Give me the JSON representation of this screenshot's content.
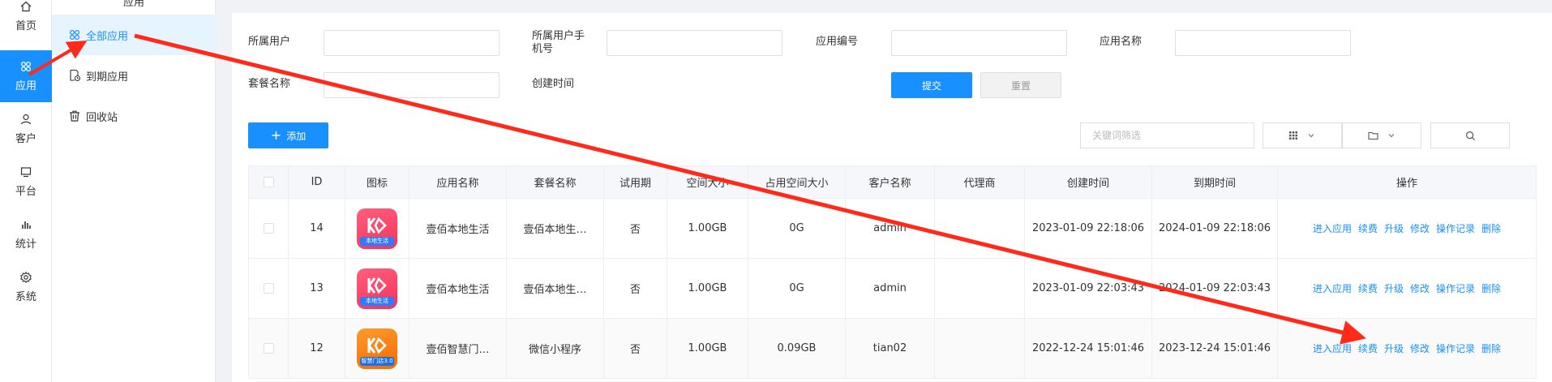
{
  "rail": {
    "items": [
      {
        "label": "首页",
        "icon": "home-icon"
      },
      {
        "label": "应用",
        "icon": "apps-icon"
      },
      {
        "label": "客户",
        "icon": "user-icon"
      },
      {
        "label": "平台",
        "icon": "monitor-icon"
      },
      {
        "label": "统计",
        "icon": "bar-chart-icon"
      },
      {
        "label": "系统",
        "icon": "gear-icon"
      }
    ],
    "active_color": "#1890ff"
  },
  "submenu": {
    "title": "应用",
    "items": [
      {
        "label": "全部应用",
        "icon": "apps-icon"
      },
      {
        "label": "到期应用",
        "icon": "expire-doc-icon"
      },
      {
        "label": "回收站",
        "icon": "trash-icon"
      }
    ]
  },
  "filters": {
    "owner_label": "所属用户",
    "phone_label_line1": "所属用户手",
    "phone_label_line2": "机号",
    "app_no_label": "应用编号",
    "app_name_label": "应用名称",
    "package_label": "套餐名称",
    "created_label": "创建时间",
    "submit": "提交",
    "reset": "重置"
  },
  "toolbar": {
    "add": "添加",
    "keyword_placeholder": "关键词筛选"
  },
  "table": {
    "headers": [
      "ID",
      "图标",
      "应用名称",
      "套餐名称",
      "试用期",
      "空间大小",
      "占用空间大小",
      "客户名称",
      "代理商",
      "创建时间",
      "到期时间",
      "操作"
    ],
    "rows": [
      {
        "id": "14",
        "icon_badge": "本地生活",
        "icon_style": "pink",
        "app_name": "壹佰本地生活",
        "package": "壹佰本地生…",
        "trial": "否",
        "space": "1.00GB",
        "used": "0G",
        "customer": "admin",
        "agent": "",
        "created": "2023-01-09 22:18:06",
        "expires": "2024-01-09 22:18:06"
      },
      {
        "id": "13",
        "icon_badge": "本地生活",
        "icon_style": "pink",
        "app_name": "壹佰本地生活",
        "package": "壹佰本地生…",
        "trial": "否",
        "space": "1.00GB",
        "used": "0G",
        "customer": "admin",
        "agent": "",
        "created": "2023-01-09 22:03:43",
        "expires": "2024-01-09 22:03:43"
      },
      {
        "id": "12",
        "icon_badge": "智慧门店3.0",
        "icon_style": "orange",
        "app_name": "壹佰智慧门…",
        "package": "微信小程序",
        "trial": "否",
        "space": "1.00GB",
        "used": "0.09GB",
        "customer": "tian02",
        "agent": "",
        "created": "2022-12-24 15:01:46",
        "expires": "2023-12-24 15:01:46"
      }
    ],
    "actions": [
      "进入应用",
      "续费",
      "升级",
      "修改",
      "操作记录",
      "删除"
    ]
  },
  "annotation_color": "#ff2a1a"
}
